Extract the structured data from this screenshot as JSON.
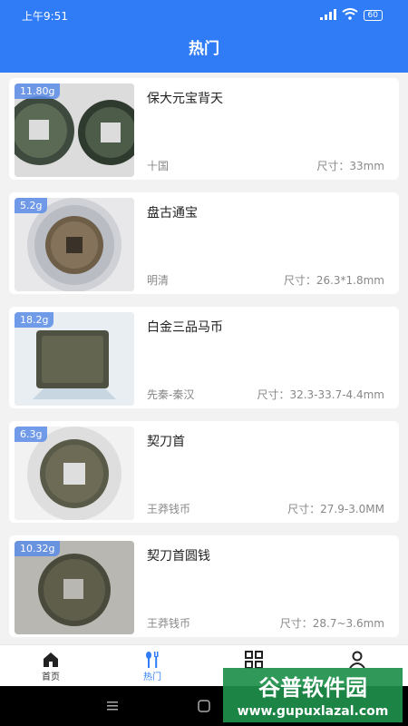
{
  "status_bar": {
    "time": "上午9:51",
    "battery": "60"
  },
  "header": {
    "title": "热门"
  },
  "items": [
    {
      "weight": "11.80g",
      "name": "保大元宝背天",
      "era": "十国",
      "size": "尺寸：33mm"
    },
    {
      "weight": "5.2g",
      "name": "盘古通宝",
      "era": "明清",
      "size": "尺寸：26.3*1.8mm"
    },
    {
      "weight": "18.2g",
      "name": "白金三品马币",
      "era": "先秦-秦汉",
      "size": "尺寸：32.3-33.7-4.4mm"
    },
    {
      "weight": "6.3g",
      "name": "契刀首",
      "era": "王莽钱币",
      "size": "尺寸：27.9-3.0MM"
    },
    {
      "weight": "10.32g",
      "name": "契刀首圆钱",
      "era": "王莽钱币",
      "size": "尺寸：28.7~3.6mm"
    }
  ],
  "bottom_nav": [
    {
      "label": "首页",
      "icon": "home-icon"
    },
    {
      "label": "热门",
      "icon": "hot-icon",
      "active": true
    },
    {
      "label": "",
      "icon": "grid-icon"
    },
    {
      "label": "",
      "icon": "profile-icon"
    }
  ],
  "watermark": {
    "line1": "谷普软件园",
    "line2": "www.gupuxlazal.com"
  },
  "colors": {
    "primary": "#2f7cf6",
    "background": "#f2f2f2"
  }
}
